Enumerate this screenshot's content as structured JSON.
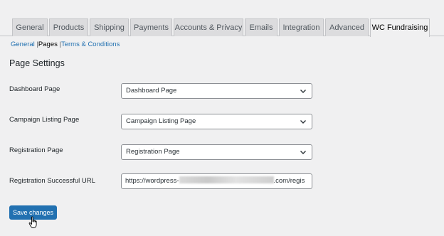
{
  "tabs": [
    {
      "label": "General",
      "active": false
    },
    {
      "label": "Products",
      "active": false
    },
    {
      "label": "Shipping",
      "active": false
    },
    {
      "label": "Payments",
      "active": false
    },
    {
      "label": "Accounts & Privacy",
      "active": false
    },
    {
      "label": "Emails",
      "active": false
    },
    {
      "label": "Integration",
      "active": false
    },
    {
      "label": "Advanced",
      "active": false
    },
    {
      "label": "WC Fundraising",
      "active": true
    }
  ],
  "subnav": {
    "general": "General",
    "sep1": "|",
    "pages": "Pages",
    "sep2": "|",
    "terms": "Terms & Conditions"
  },
  "section_title": "Page Settings",
  "fields": {
    "dashboard": {
      "label": "Dashboard Page",
      "value": "Dashboard Page"
    },
    "campaign_listing": {
      "label": "Campaign Listing Page",
      "value": "Campaign Listing Page"
    },
    "registration": {
      "label": "Registration Page",
      "value": "Registration Page"
    },
    "registration_url": {
      "label": "Registration Successful URL",
      "value_prefix": "https://wordpress-",
      "value_suffix": ".com/regis"
    }
  },
  "save_button": "Save changes",
  "colors": {
    "primary": "#2271b1",
    "background": "#f0f0f1",
    "link": "#2271b1"
  }
}
